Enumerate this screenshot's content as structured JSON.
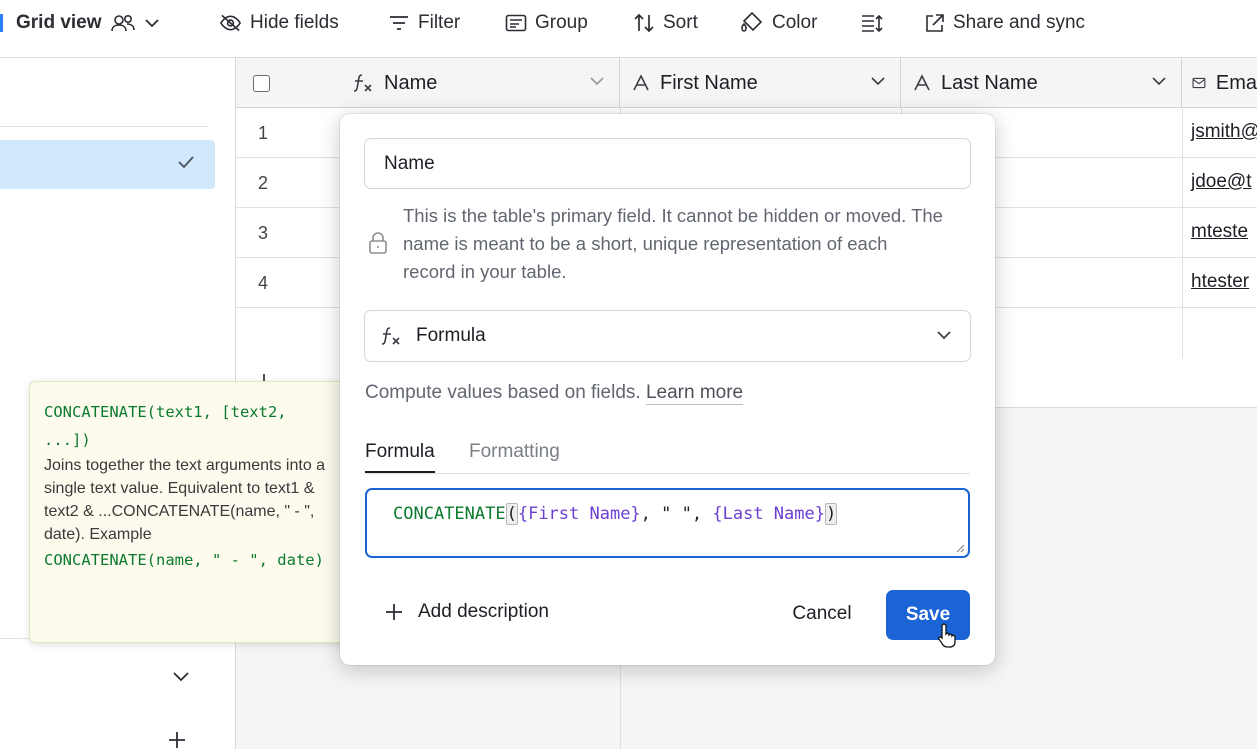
{
  "toolbar": {
    "view_name": "Grid view",
    "hide_fields": "Hide fields",
    "filter": "Filter",
    "group": "Group",
    "sort": "Sort",
    "color": "Color",
    "share_and_sync": "Share and sync"
  },
  "grid": {
    "columns": [
      {
        "label": "Name",
        "icon": "formula-icon"
      },
      {
        "label": "First Name",
        "icon": "text-icon"
      },
      {
        "label": "Last Name",
        "icon": "text-icon"
      },
      {
        "label": "Ema",
        "icon": "email-icon"
      }
    ],
    "rows": [
      {
        "num": "1",
        "email": "jsmith@"
      },
      {
        "num": "2",
        "email": "jdoe@t"
      },
      {
        "num": "3",
        "email": "mteste"
      },
      {
        "num": "4",
        "email": "htester"
      }
    ]
  },
  "tooltip": {
    "signature": "CONCATENATE(text1, [text2, ...])",
    "description": "Joins together the text arguments into a single text value. Equivalent to text1 & text2 & ...CONCATENATE(name, \" - \", date). Example",
    "example": "CONCATENATE(name, \" - \", date)"
  },
  "dialog": {
    "field_name": "Name",
    "primary_note": "This is the table's primary field. It cannot be hidden or moved. The name is meant to be a short, unique representation of each record in your table.",
    "field_type": "Formula",
    "compute_text": "Compute values based on fields.",
    "learn_more": "Learn more",
    "tabs": {
      "formula": "Formula",
      "formatting": "Formatting"
    },
    "formula": {
      "func": "CONCATENATE",
      "open": "(",
      "field1": "{First Name}",
      "sep1": ", ",
      "literal": "\" \"",
      "sep2": ", ",
      "field2": "{Last Name}",
      "close": ")"
    },
    "add_description": "Add description",
    "cancel": "Cancel",
    "save": "Save"
  },
  "colors": {
    "accent": "#1b64d6",
    "selected_bg": "#cfe8fc",
    "formula_func": "#0b7a2e",
    "formula_field": "#6b3fd4",
    "tooltip_bg": "#fdfbee"
  }
}
